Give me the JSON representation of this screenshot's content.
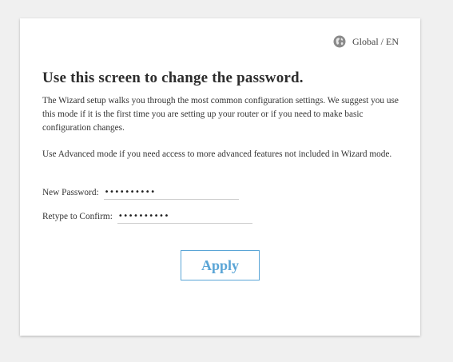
{
  "header": {
    "region_label": "Global / EN",
    "region_icon": "globe-icon"
  },
  "main": {
    "title": "Use this screen to change the password.",
    "paragraph1": "The Wizard setup walks you through the most common configuration settings. We suggest you use this mode if it is the first time you are setting up your router or if you need to make basic configuration changes.",
    "paragraph2": "Use Advanced mode if you need access to more advanced features not included in Wizard mode."
  },
  "form": {
    "new_password_label": "New Password:",
    "new_password_value": "••••••••••",
    "confirm_label": "Retype to Confirm:",
    "confirm_value": "••••••••••",
    "apply_label": "Apply"
  },
  "colors": {
    "accent": "#5aa5d6",
    "background": "#f0f0f0",
    "card": "#ffffff"
  }
}
